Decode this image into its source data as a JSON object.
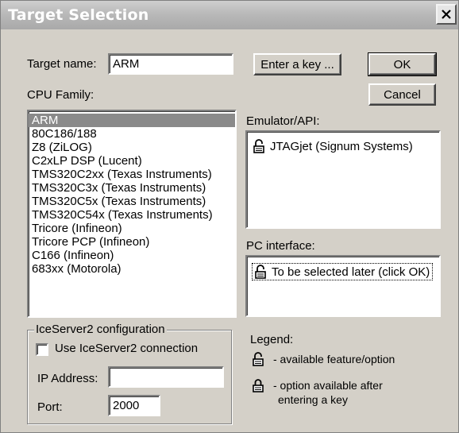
{
  "window": {
    "title": "Target Selection"
  },
  "target": {
    "label": "Target name:",
    "value": "ARM"
  },
  "buttons": {
    "enter_key": "Enter a key ...",
    "ok": "OK",
    "cancel": "Cancel"
  },
  "cpu": {
    "label": "CPU Family:",
    "selected_index": 0,
    "items": [
      "ARM",
      "80C186/188",
      "Z8 (ZiLOG)",
      "C2xLP DSP (Lucent)",
      "TMS320C2xx (Texas Instruments)",
      "TMS320C3x (Texas Instruments)",
      "TMS320C5x (Texas Instruments)",
      "TMS320C54x (Texas Instruments)",
      "Tricore (Infineon)",
      "Tricore PCP (Infineon)",
      "C166 (Infineon)",
      "683xx (Motorola)"
    ]
  },
  "emulator": {
    "label": "Emulator/API:",
    "item": "JTAGjet (Signum Systems)",
    "icon": "unlocked-padlock-icon"
  },
  "pc_interface": {
    "label": "PC interface:",
    "item": "To be selected later (click OK)",
    "icon": "unlocked-padlock-icon"
  },
  "iceserver": {
    "group_label": "IceServer2 configuration",
    "checkbox_label": "Use IceServer2 connection",
    "checked": false,
    "ip_label": "IP Address:",
    "ip_value": "",
    "port_label": "Port:",
    "port_value": "2000"
  },
  "legend": {
    "label": "Legend:",
    "available": "- available feature/option",
    "key_line1": "- option available after",
    "key_line2": "entering a key",
    "available_icon": "unlocked-padlock-icon",
    "locked_icon": "locked-padlock-icon"
  }
}
